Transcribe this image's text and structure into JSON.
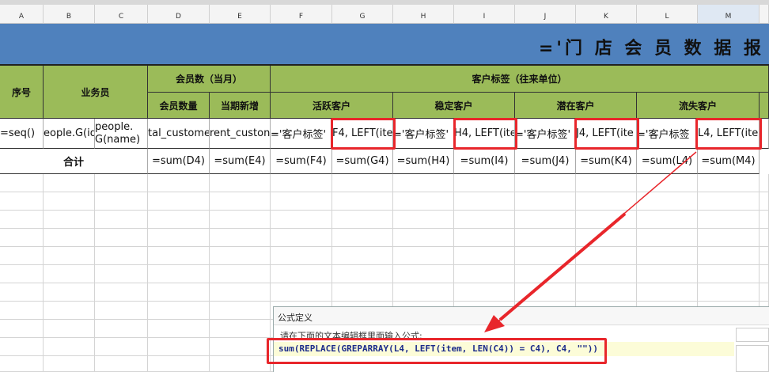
{
  "columns": [
    "A",
    "B",
    "C",
    "D",
    "E",
    "F",
    "G",
    "H",
    "I",
    "J",
    "K",
    "L",
    "M"
  ],
  "title": "='门 店 会 员 数 据 报",
  "headers": {
    "seq": "序号",
    "salesman": "业务员",
    "members": "会员数（当月）",
    "member_count": "会员数量",
    "new_members": "当期新增",
    "tags": "客户标签（往来单位）",
    "active": "活跃客户",
    "stable": "稳定客户",
    "potential": "潜在客户",
    "lost": "流失客户"
  },
  "row4": [
    "=seq()",
    "eople.G(id",
    "people.\nG(name)",
    "tal_custome",
    "rent_custon",
    "='客户标签'",
    "F4, LEFT(ite",
    "='客户标签'",
    "H4, LEFT(ite",
    "='客户标签'",
    "J4, LEFT(ite",
    "='客户标签",
    "L4, LEFT(ite"
  ],
  "row5": {
    "label": "合计",
    "sums": [
      "=sum(D4)",
      "=sum(E4)",
      "=sum(F4)",
      "=sum(G4)",
      "=sum(H4)",
      "=sum(I4)",
      "=sum(J4)",
      "=sum(K4)",
      "=sum(L4)",
      "=sum(M4)"
    ]
  },
  "dialog": {
    "title": "公式定义",
    "prompt": "请在下面的文本编辑框里面输入公式:",
    "formula": "sum(REPLACE(GREPARRAY(L4, LEFT(item, LEN(C4)) = C4), C4, \"\"))"
  },
  "colors": {
    "header_green": "#9bbb59",
    "title_blue": "#4f81bd",
    "annotation_red": "#e8262b"
  }
}
